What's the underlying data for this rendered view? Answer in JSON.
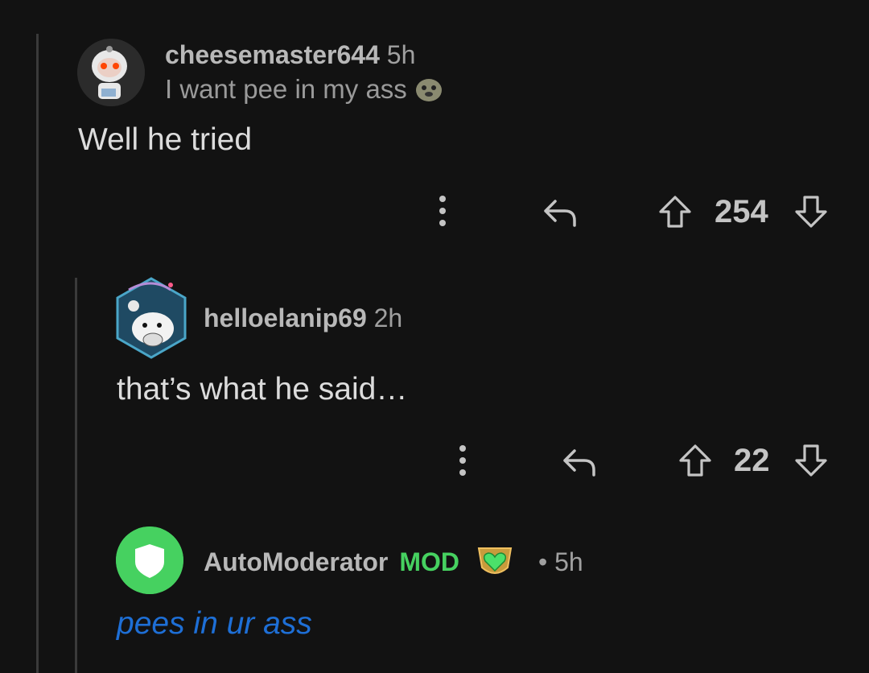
{
  "comments": [
    {
      "username": "cheesemaster644",
      "time": "5h",
      "flair": "I want pee in my ass",
      "body": "Well he tried",
      "score": "254"
    },
    {
      "username": "helloelanip69",
      "time": "2h",
      "body": "that’s what he said…",
      "score": "22"
    },
    {
      "username": "AutoModerator",
      "mod_badge": "MOD",
      "time": "• 5h",
      "body": "pees in ur ass"
    }
  ],
  "colors": {
    "background": "#121212",
    "mod_green": "#46d160",
    "link_blue": "#1e6fd6",
    "text": "#d7d7d7",
    "muted": "#a0a0a0"
  },
  "icons": [
    "more-icon",
    "reply-icon",
    "upvote-icon",
    "downvote-icon",
    "shield-icon",
    "heart-award-icon"
  ]
}
